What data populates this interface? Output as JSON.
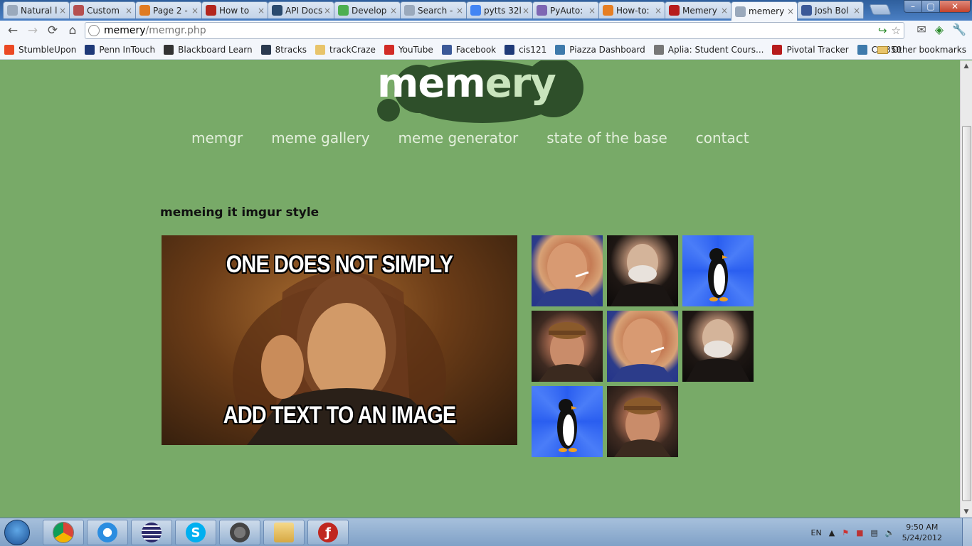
{
  "browser": {
    "tabs": [
      {
        "title": "Natural l",
        "favicon_color": "#9aa9bc"
      },
      {
        "title": "Custom",
        "favicon_color": "#b54f4f"
      },
      {
        "title": "Page 2 -",
        "favicon_color": "#e07b22"
      },
      {
        "title": "How to",
        "favicon_color": "#b3261e"
      },
      {
        "title": "API Docs",
        "favicon_color": "#2a4a6e"
      },
      {
        "title": "Develop",
        "favicon_color": "#4caf50"
      },
      {
        "title": "Search -",
        "favicon_color": "#9aa9bc"
      },
      {
        "title": "pytts 32l",
        "favicon_color": "#4285f4"
      },
      {
        "title": "PyAuto:",
        "favicon_color": "#7e67b3"
      },
      {
        "title": "How-to:",
        "favicon_color": "#e67e22"
      },
      {
        "title": "Memery",
        "favicon_color": "#b71c1c"
      },
      {
        "title": "memery",
        "favicon_color": "#9aa9bc",
        "active": true
      },
      {
        "title": "Josh Bol",
        "favicon_color": "#3b5998"
      }
    ],
    "url_host": "memery",
    "url_path": "/memgr.php",
    "bookmarks": [
      {
        "label": "StumbleUpon",
        "color": "#eb4924"
      },
      {
        "label": "Penn InTouch",
        "color": "#1f3a78"
      },
      {
        "label": "Blackboard Learn",
        "color": "#333333"
      },
      {
        "label": "8tracks",
        "color": "#2b3a4f"
      },
      {
        "label": "trackCraze",
        "color": "#e8c46a"
      },
      {
        "label": "YouTube",
        "color": "#d22c26"
      },
      {
        "label": "Facebook",
        "color": "#3b5998"
      },
      {
        "label": "cis121",
        "color": "#1f3a78"
      },
      {
        "label": "Piazza Dashboard",
        "color": "#3e7aab"
      },
      {
        "label": "Aplia: Student Cours...",
        "color": "#777777"
      },
      {
        "label": "Pivotal Tracker",
        "color": "#b71c1c"
      },
      {
        "label": "CIS350",
        "color": "#3e7aab"
      }
    ],
    "other_bookmarks": "Other bookmarks"
  },
  "page": {
    "logo_main": "mem",
    "logo_accent": "ery",
    "nav": [
      "memgr",
      "meme gallery",
      "meme generator",
      "state of the base",
      "contact"
    ],
    "section_title": "memeing it imgur style",
    "hero_top_caption": "ONE DOES NOT SIMPLY",
    "hero_bottom_caption": "ADD TEXT TO AN IMAGE",
    "thumbnails": [
      "greg",
      "dos",
      "penguin",
      "scumbag",
      "greg",
      "dos",
      "penguin",
      "scumbag"
    ]
  },
  "colors": {
    "page_bg": "#78aa68",
    "logo_cloud": "#2e4f2a",
    "nav_text": "#e3efdc"
  },
  "taskbar": {
    "lang": "EN",
    "time": "9:50 AM",
    "date": "5/24/2012",
    "apps": [
      "chrome",
      "app-circle",
      "eclipse",
      "skype",
      "utility",
      "file-explorer",
      "flash"
    ]
  }
}
